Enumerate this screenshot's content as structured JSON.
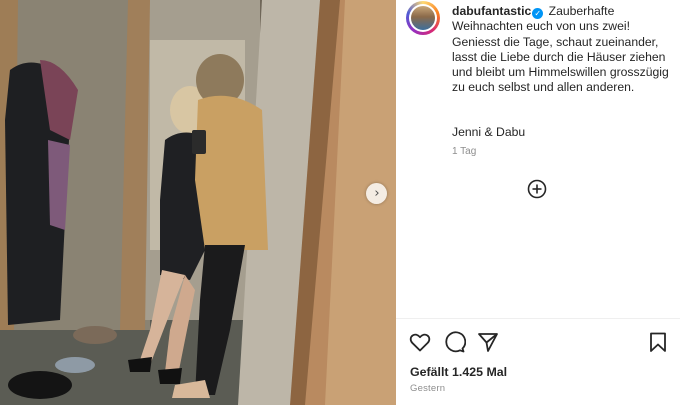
{
  "post": {
    "username": "dabufantastic",
    "caption_text": "Zauberhafte Weihnachten euch von uns zwei! Geniesst die Tage, schaut zueinander, lasst die Liebe durch die Häuser ziehen und bleibt um Himmelswillen grosszügig zu euch selbst und allen anderen.",
    "signature": "Jenni & Dabu",
    "time_ago": "1 Tag",
    "likes": "Gefällt 1.425 Mal",
    "date": "Gestern"
  },
  "icons": {
    "verified": "verified-badge-icon",
    "next": "chevron-right-icon",
    "add": "plus-circle-icon",
    "like": "heart-icon",
    "comment": "comment-icon",
    "share": "paper-plane-icon",
    "save": "bookmark-icon"
  },
  "colors": {
    "accent": "#0095f6",
    "text": "#262626",
    "muted": "#8e8e8e"
  }
}
